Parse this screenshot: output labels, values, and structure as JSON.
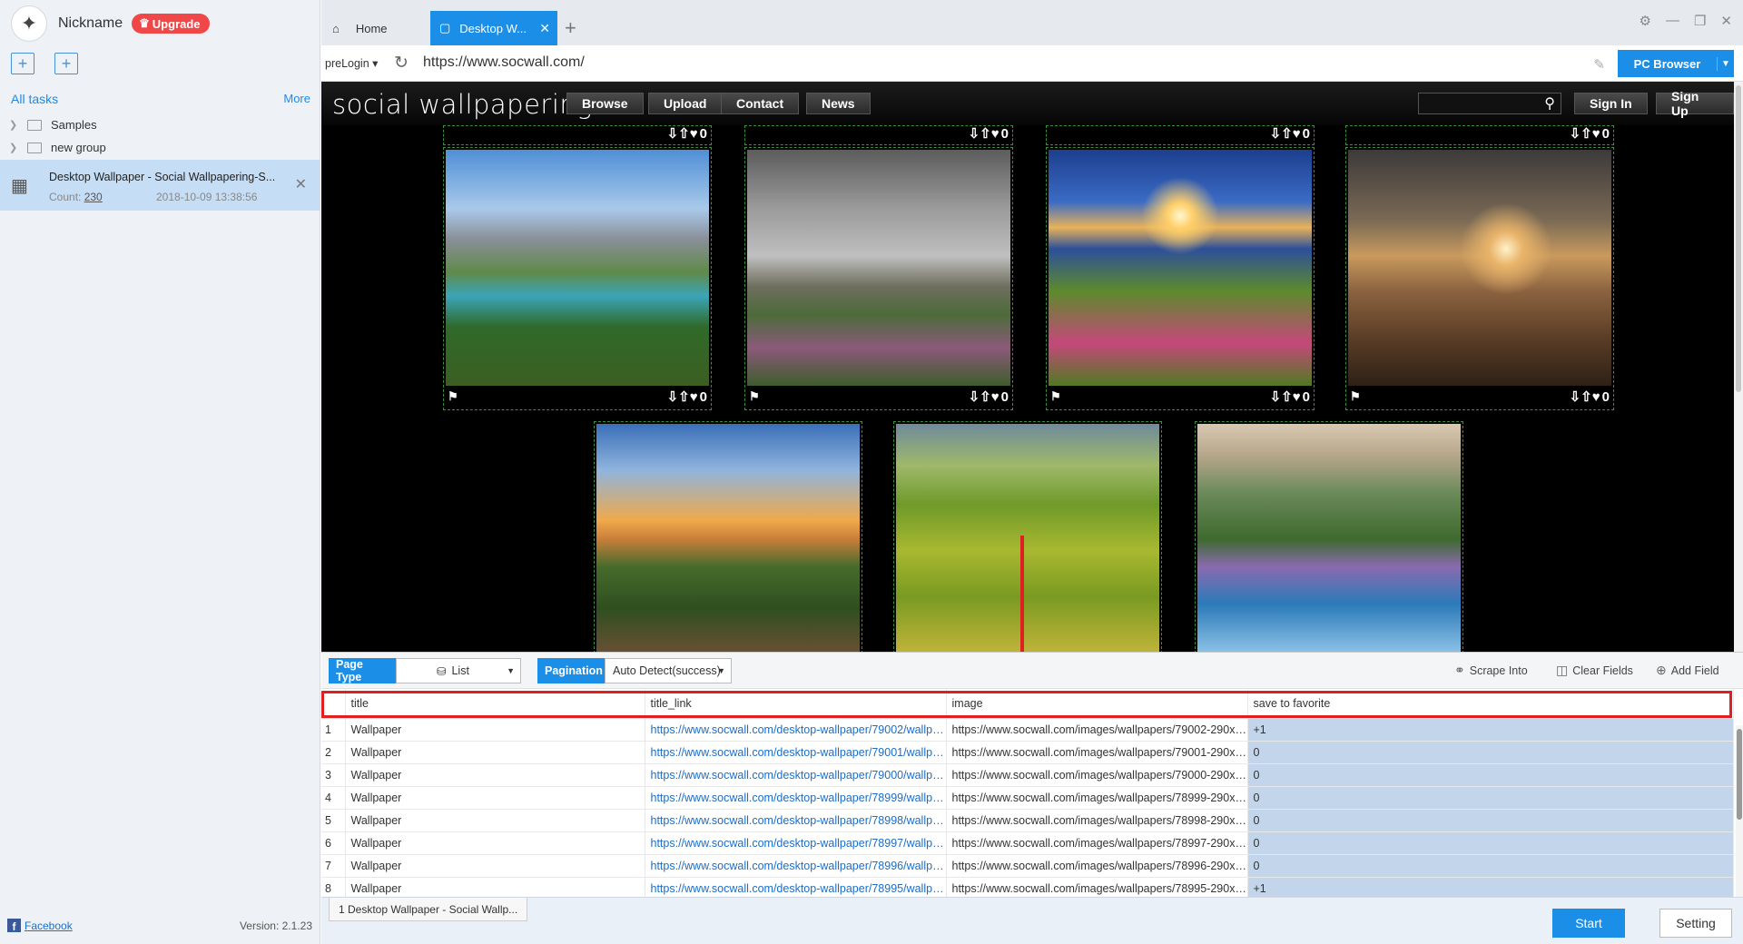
{
  "user": {
    "nickname": "Nickname",
    "upgrade_label": "Upgrade"
  },
  "sidebar": {
    "all_tasks_label": "All tasks",
    "more_label": "More",
    "groups": [
      {
        "label": "Samples"
      },
      {
        "label": "new group"
      }
    ],
    "task": {
      "name": "Desktop Wallpaper - Social Wallpapering-S...",
      "count_label": "Count:",
      "count": "230",
      "date": "2018-10-09 13:38:56"
    },
    "facebook_label": "Facebook",
    "version": "Version: 2.1.23"
  },
  "tabs": {
    "home": "Home",
    "active": "Desktop W..."
  },
  "address": {
    "prelogin": "preLogin",
    "url": "https://www.socwall.com/",
    "pc_browser": "PC Browser"
  },
  "site": {
    "logo": "social wallpapering",
    "nav": [
      "Browse",
      "Upload",
      "Contact",
      "News"
    ],
    "sign_in": "Sign In",
    "sign_up": "Sign Up",
    "vote_count": "0"
  },
  "panel": {
    "page_type_label": "Page Type",
    "page_type_value": "List",
    "pagination_label": "Pagination",
    "pagination_value": "Auto Detect(success)",
    "scrape_into": "Scrape Into",
    "clear_fields": "Clear Fields",
    "add_field": "Add Field",
    "columns": [
      "title",
      "title_link",
      "image",
      "save to favorite"
    ],
    "rows": [
      {
        "n": "1",
        "title": "Wallpaper",
        "link": "https://www.socwall.com/desktop-wallpaper/79002/wallpa...",
        "image": "https://www.socwall.com/images/wallpapers/79002-290x2...",
        "fav": "+1"
      },
      {
        "n": "2",
        "title": "Wallpaper",
        "link": "https://www.socwall.com/desktop-wallpaper/79001/wallpa...",
        "image": "https://www.socwall.com/images/wallpapers/79001-290x2...",
        "fav": "0"
      },
      {
        "n": "3",
        "title": "Wallpaper",
        "link": "https://www.socwall.com/desktop-wallpaper/79000/wallpa...",
        "image": "https://www.socwall.com/images/wallpapers/79000-290x2...",
        "fav": "0"
      },
      {
        "n": "4",
        "title": "Wallpaper",
        "link": "https://www.socwall.com/desktop-wallpaper/78999/wallpa...",
        "image": "https://www.socwall.com/images/wallpapers/78999-290x2...",
        "fav": "0"
      },
      {
        "n": "5",
        "title": "Wallpaper",
        "link": "https://www.socwall.com/desktop-wallpaper/78998/wallpa...",
        "image": "https://www.socwall.com/images/wallpapers/78998-290x2...",
        "fav": "0"
      },
      {
        "n": "6",
        "title": "Wallpaper",
        "link": "https://www.socwall.com/desktop-wallpaper/78997/wallpa...",
        "image": "https://www.socwall.com/images/wallpapers/78997-290x2...",
        "fav": "0"
      },
      {
        "n": "7",
        "title": "Wallpaper",
        "link": "https://www.socwall.com/desktop-wallpaper/78996/wallpa...",
        "image": "https://www.socwall.com/images/wallpapers/78996-290x2...",
        "fav": "0"
      },
      {
        "n": "8",
        "title": "Wallpaper",
        "link": "https://www.socwall.com/desktop-wallpaper/78995/wallpa...",
        "image": "https://www.socwall.com/images/wallpapers/78995-290x2...",
        "fav": "+1"
      }
    ]
  },
  "status": {
    "task_tab": "1 Desktop Wallpaper - Social Wallp...",
    "start": "Start",
    "setting": "Setting"
  },
  "colors": {
    "accent": "#1b8fe8",
    "upgrade": "#f04848",
    "highlight": "#e02020"
  }
}
